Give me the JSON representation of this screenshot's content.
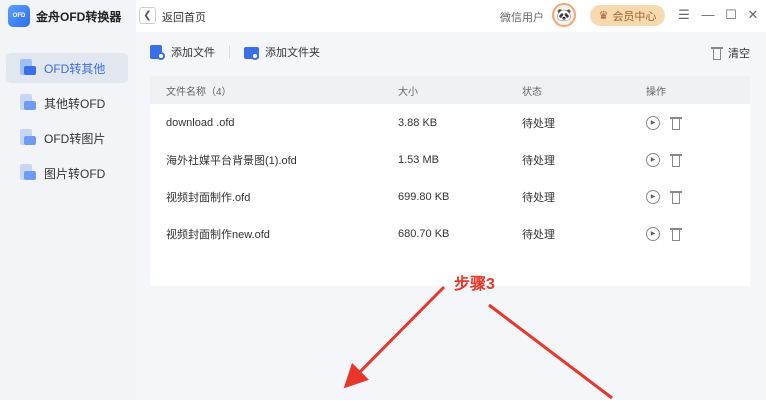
{
  "app": {
    "logo_text": "OFD",
    "title": "金舟OFD转换器"
  },
  "sidebar": {
    "items": [
      {
        "label": "OFD转其他",
        "active": true
      },
      {
        "label": "其他转OFD",
        "active": false
      },
      {
        "label": "OFD转图片",
        "active": false
      },
      {
        "label": "图片转OFD",
        "active": false
      }
    ]
  },
  "topbar": {
    "back_label": "返回首页",
    "user_name": "微信用户",
    "vip_label": "会员中心",
    "window_controls": [
      "menu",
      "minimize",
      "maximize",
      "close"
    ]
  },
  "toolbar": {
    "add_file_label": "添加文件",
    "add_folder_label": "添加文件夹",
    "clear_label": "清空"
  },
  "table": {
    "headers": {
      "name": "文件名称（4）",
      "size": "大小",
      "status": "状态",
      "ops": "操作"
    },
    "rows": [
      {
        "name": "download .ofd",
        "size": "3.88 KB",
        "status": "待处理"
      },
      {
        "name": "海外社媒平台背景图(1).ofd",
        "size": "1.53 MB",
        "status": "待处理"
      },
      {
        "name": "视频封面制作.ofd",
        "size": "699.80 KB",
        "status": "待处理"
      },
      {
        "name": "视频封面制作new.ofd",
        "size": "680.70 KB",
        "status": "待处理"
      }
    ]
  },
  "annotation": {
    "text": "步骤3",
    "color": "#e8372a"
  },
  "colors": {
    "accent": "#3a6fe8",
    "vip_bg": "#f7d9b0",
    "arrow": "#e8372a"
  }
}
